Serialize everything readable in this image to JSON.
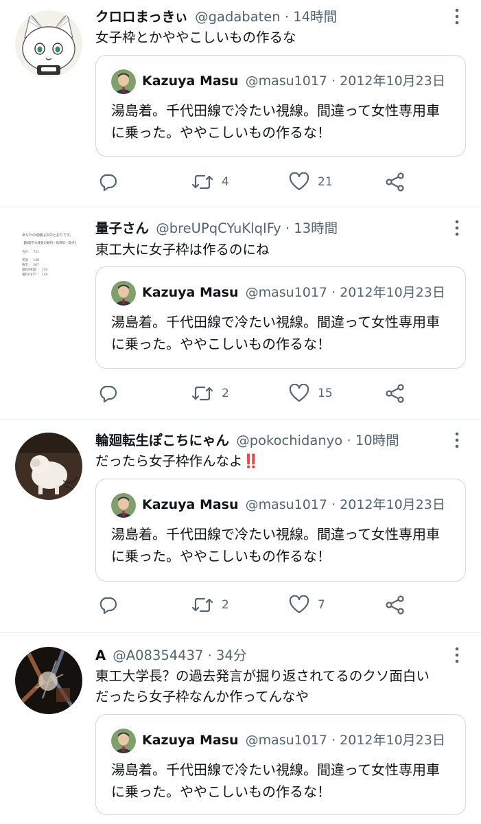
{
  "tweets": [
    {
      "author_name": "クロロまっきぃ",
      "handle": "@gadabaten",
      "time": "14時間",
      "text": "女子枠とかややこしいもの作るな",
      "quote": {
        "author_name": "Kazuya Masu",
        "handle": "@masu1017",
        "date": "2012年10月23日",
        "text": "湯島着。千代田線で冷たい視線。間違って女性専用車に乗った。ややこしいもの作るな！"
      },
      "retweets": "4",
      "likes": "21"
    },
    {
      "author_name": "量子さん",
      "handle": "@breUPqCYuKlqIFy",
      "time": "13時間",
      "text": "東工大に女子枠は作るのにね",
      "quote": {
        "author_name": "Kazuya Masu",
        "handle": "@masu1017",
        "date": "2012年10月23日",
        "text": "湯島着。千代田線で冷たい視線。間違って女性専用車に乗った。ややこしいもの作るな！"
      },
      "retweets": "2",
      "likes": "15"
    },
    {
      "author_name": "輪廻転生ぽこちにゃん",
      "handle": "@pokochidanyo",
      "time": "10時間",
      "text": "だったら女子枠作んなよ",
      "text_emoji": "‼️",
      "quote": {
        "author_name": "Kazuya Masu",
        "handle": "@masu1017",
        "date": "2012年10月23日",
        "text": "湯島着。千代田線で冷たい視線。間違って女性専用車に乗った。ややこしいもの作るな！"
      },
      "retweets": "2",
      "likes": "7"
    },
    {
      "author_name": "A",
      "handle": "@A08354437",
      "time": "34分",
      "text_line1": "東工大学長？の過去発言が掘り返されてるのクソ面白い",
      "text_line2": "だったら女子枠なんか作ってんなや",
      "quote": {
        "author_name": "Kazuya Masu",
        "handle": "@masu1017",
        "date": "2012年10月23日",
        "text": "湯島着。千代田線で冷たい視線。間違って女性専用車に乗った。ややこしいもの作るな！"
      }
    }
  ],
  "avatar2_lines": [
    "あなたの成績は次のとおりです。",
    "【数理学力検査の数列・指導等・得点】",
    "合計 ： 751",
    "英語 ： 148",
    "数学 ： 207",
    "理科(物理) ： 150",
    "理科(化学) ： 146"
  ],
  "icons": {
    "reply": "reply-icon",
    "retweet": "retweet-icon",
    "like": "heart-icon",
    "share": "share-icon",
    "more": "more-icon"
  },
  "colors": {
    "text": "#0f1419",
    "secondary": "#536471",
    "border": "#cfd9de",
    "divider": "#e6ecf0",
    "emoji_red": "#d0102a"
  }
}
